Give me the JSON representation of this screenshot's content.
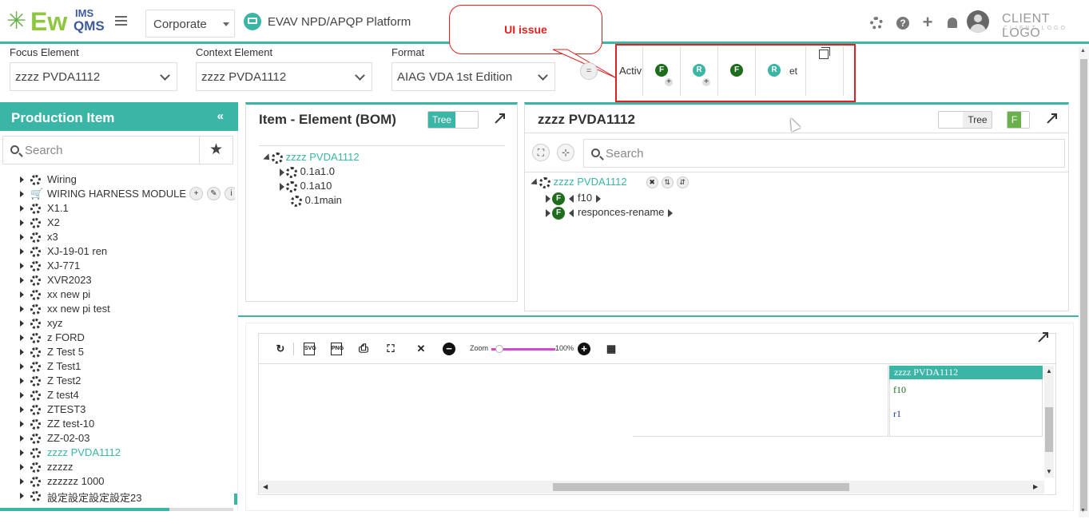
{
  "header": {
    "logo_main": "Ew",
    "logo_top": "IMS",
    "logo_bottom": "QMS",
    "org_select": "Corporate",
    "platform_title": "EVAV NPD/APQP Platform",
    "client_logo": "CLIENT LOGO",
    "client_logo_sub": "CLIENT LOGO",
    "icons": [
      "settings-icon",
      "help-icon",
      "add-icon",
      "bell-icon",
      "avatar"
    ]
  },
  "filters": {
    "focus_label": "Focus Element",
    "focus_value": "zzzz PVDA1112",
    "context_label": "Context Element",
    "context_value": "zzzz PVDA1112",
    "format_label": "Format",
    "format_value": "AIAG VDA 1st Edition"
  },
  "activity": {
    "label": "Activ",
    "items": [
      "F",
      "R",
      "F",
      "R"
    ],
    "tail": "et"
  },
  "annotation": {
    "callout": "UI issue"
  },
  "left_panel": {
    "title": "Production Item",
    "search_placeholder": "Search",
    "items": [
      {
        "label": "Wiring"
      },
      {
        "label": "WIRING HARNESS MODULE"
      },
      {
        "label": "X1.1"
      },
      {
        "label": "X2"
      },
      {
        "label": "x3"
      },
      {
        "label": "XJ-19-01 ren"
      },
      {
        "label": "XJ-771"
      },
      {
        "label": "XVR2023"
      },
      {
        "label": "xx new pi"
      },
      {
        "label": "xx new pi test"
      },
      {
        "label": "xyz"
      },
      {
        "label": "z FORD"
      },
      {
        "label": "Z Test 5"
      },
      {
        "label": "Z Test1"
      },
      {
        "label": "Z Test2"
      },
      {
        "label": "Z test4"
      },
      {
        "label": "ZTEST3"
      },
      {
        "label": "ZZ test-10"
      },
      {
        "label": "ZZ-02-03"
      },
      {
        "label": "zzzz PVDA1112"
      },
      {
        "label": "zzzzz"
      },
      {
        "label": "zzzzzz 1000"
      },
      {
        "label": "設定設定設定設定23"
      }
    ],
    "selected_index": 19
  },
  "bom_panel": {
    "title": "Item - Element (BOM)",
    "toggle_on": "Tree",
    "root": "zzzz PVDA1112",
    "children": [
      "0.1a1.0",
      "0.1a10",
      "0.1main"
    ]
  },
  "detail_panel": {
    "title": "zzzz PVDA1112",
    "toggle_off": "Tree",
    "toggle_badge": "F",
    "search_placeholder": "Search",
    "root": "zzzz PVDA1112",
    "functions": [
      {
        "badge": "F",
        "label": "f10"
      },
      {
        "badge": "F",
        "label": "responces-rename"
      }
    ]
  },
  "diagram": {
    "zoom_label": "Zoom",
    "zoom_value": "100%",
    "zoom_level": 0.13,
    "node_title": "zzzz PVDA1112",
    "node_f": "f10",
    "node_r": "r1"
  }
}
